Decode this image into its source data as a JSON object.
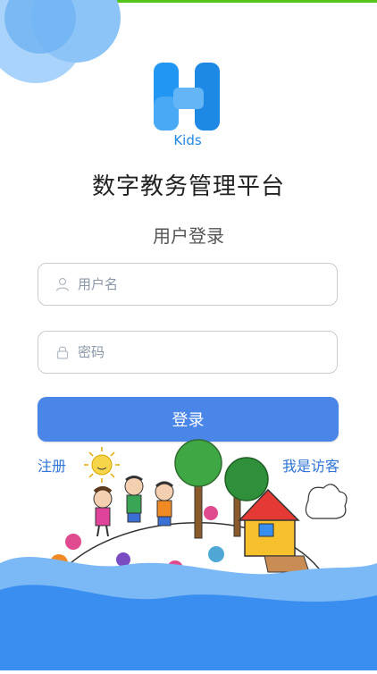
{
  "logo": {
    "text": "Kids"
  },
  "header": {
    "app_title": "数字教务管理平台",
    "subtitle": "用户登录"
  },
  "form": {
    "username_placeholder": "用户名",
    "password_placeholder": "密码",
    "login_label": "登录"
  },
  "links": {
    "register": "注册",
    "guest": "我是访客"
  },
  "colors": {
    "primary_button": "#4a86e8",
    "link": "#2f74d6",
    "wave": "#3a8ef0",
    "logo_blue": "#2196f3",
    "top_strip": "#52c41a"
  },
  "icons": [
    "user-icon",
    "lock-icon"
  ]
}
